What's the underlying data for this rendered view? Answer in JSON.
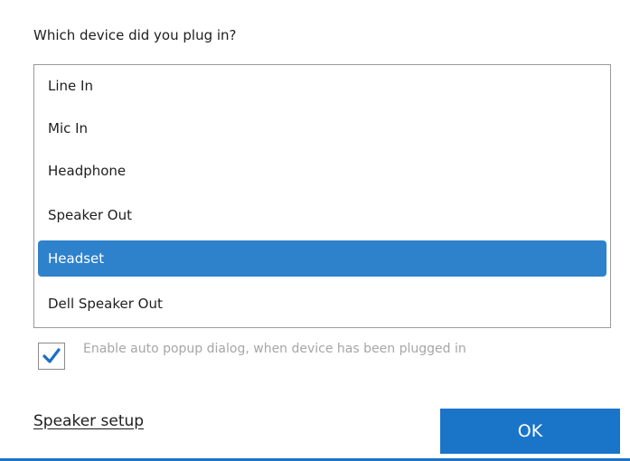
{
  "dialog": {
    "question": "Which device did you plug in?",
    "devices": [
      {
        "label": "Line In",
        "selected": false
      },
      {
        "label": "Mic In",
        "selected": false
      },
      {
        "label": "Headphone",
        "selected": false
      },
      {
        "label": "Speaker Out",
        "selected": false
      },
      {
        "label": "Headset",
        "selected": true
      },
      {
        "label": "Dell Speaker Out",
        "selected": false
      }
    ],
    "auto_popup": {
      "label": "Enable auto popup dialog, when device has been plugged in",
      "checked": true
    },
    "speaker_setup_link": "Speaker setup",
    "ok_label": "OK"
  },
  "colors": {
    "accent": "#1a75c9",
    "selection": "#2e82cc",
    "check_mark": "#1a6fc4",
    "disabled_text": "#a6a6a6"
  },
  "icons": {
    "checkbox_mark": "check-icon"
  }
}
